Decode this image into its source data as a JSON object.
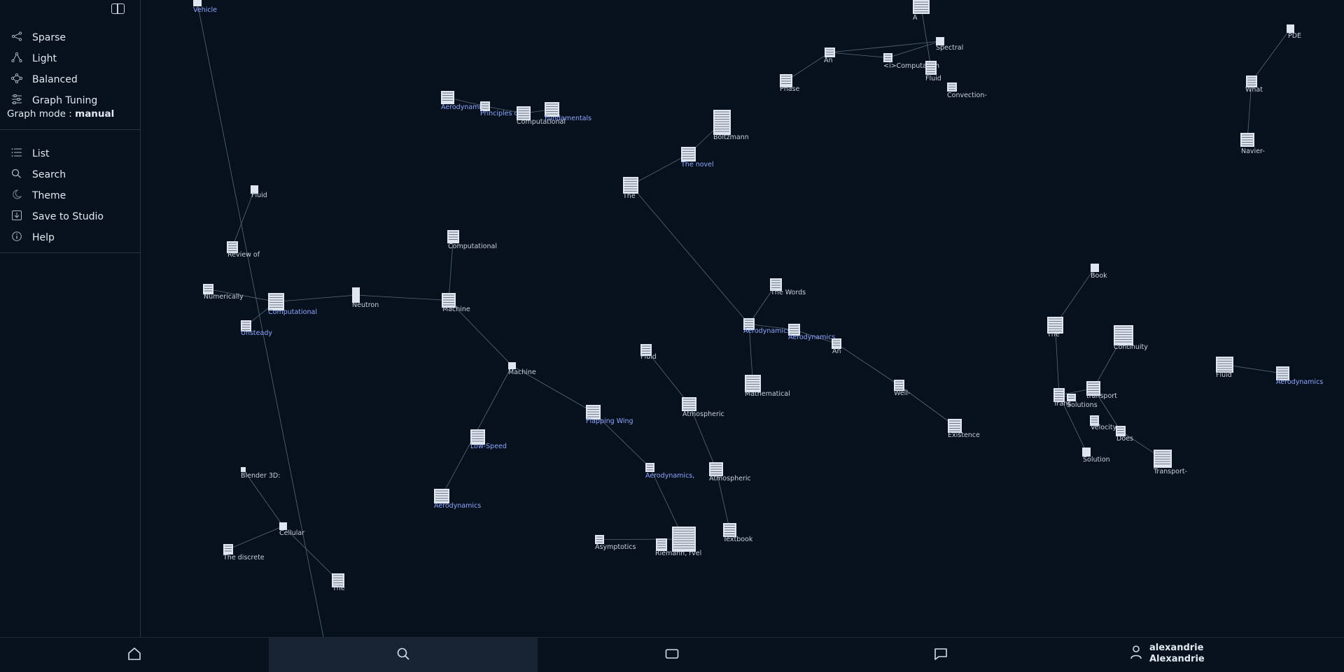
{
  "sidebar": {
    "layout_items": [
      {
        "label": "Sparse",
        "icon": "share-icon"
      },
      {
        "label": "Light",
        "icon": "graph-icon"
      },
      {
        "label": "Balanced",
        "icon": "balanced-graph-icon"
      },
      {
        "label": "Graph Tuning",
        "icon": "sliders-icon"
      }
    ],
    "graph_mode_label": "Graph mode : ",
    "graph_mode_value": "manual",
    "tool_items": [
      {
        "label": "List",
        "icon": "list-icon"
      },
      {
        "label": "Search",
        "icon": "search-icon"
      },
      {
        "label": "Theme",
        "icon": "moon-icon"
      },
      {
        "label": "Save to Studio",
        "icon": "download-icon"
      },
      {
        "label": "Help",
        "icon": "info-icon"
      }
    ]
  },
  "graph": {
    "node_labels": [
      "Vehicle",
      "A",
      "Spectral",
      "PDE",
      "An",
      "<i>Computation",
      "Fluid",
      "Phase",
      "Convection-",
      "What",
      "Aerodynamics",
      "Principles of",
      "Computational",
      "Fundamentals",
      "Boltzmann",
      "Navier-",
      "The novel",
      "The",
      "Fluid",
      "Computational",
      "Review of",
      "Numerically",
      "Computational",
      "Neutron",
      "Machine",
      "Unsteady",
      "The Words",
      "Book",
      "The",
      "Aerodynamics",
      "Aerodynamics",
      "An",
      "Continuity",
      "Fluid",
      "Fluid",
      "Aerodynamics",
      "Machine",
      "Mathematical",
      "Well-",
      "transport",
      "Flapping Wing",
      "Atmospheric",
      "Trans",
      "Solutions",
      "Velocity",
      "Does",
      "Existence",
      "Low-Speed",
      "Blender 3D:",
      "Aerodynamics,",
      "Atmospheric",
      "Solution",
      "Transport-",
      "Aerodynamics",
      "Cellular",
      "Textbook",
      "The discrete",
      "Asymptotics",
      "Riemann, rvel",
      "The"
    ]
  },
  "bottom_nav": {
    "tabs": [
      {
        "icon": "home-icon"
      },
      {
        "icon": "search-icon",
        "active": true
      },
      {
        "icon": "rectangle-icon"
      },
      {
        "icon": "chat-icon"
      }
    ],
    "username": "alexandrie",
    "display_name": "Alexandrie"
  }
}
